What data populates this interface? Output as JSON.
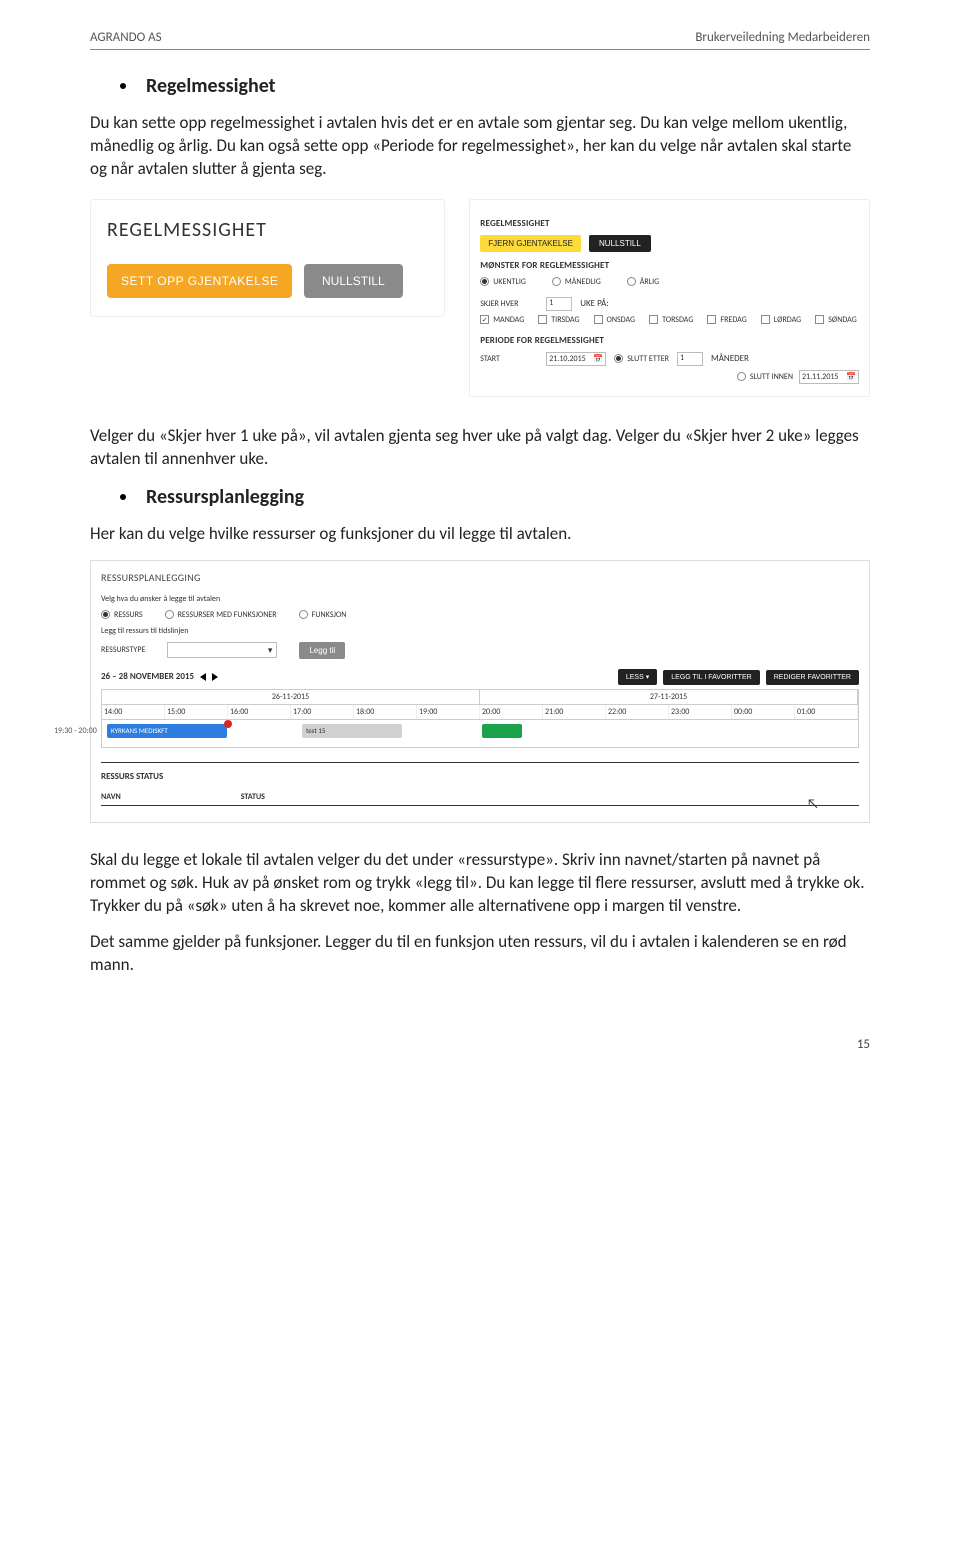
{
  "header": {
    "left": "AGRANDO AS",
    "right": "Brukerveiledning Medarbeideren"
  },
  "s1": {
    "title": "Regelmessighet",
    "p1": "Du kan sette opp regelmessighet i avtalen hvis det er en avtale som gjentar seg. Du kan velge mellom ukentlig, månedlig og årlig. Du kan også sette opp «Periode for regelmessighet», her kan du velge når avtalen skal starte og når avtalen slutter å gjenta seg.",
    "card1": {
      "title": "REGELMESSIGHET",
      "btn_set": "SETT OPP GJENTAKELSE",
      "btn_null": "NULLSTILL"
    },
    "card2": {
      "sect_top": "REGELMESSIGHET",
      "btn_fjern": "FJERN GJENTAKELSE",
      "btn_null": "NULLSTILL",
      "sect_pattern": "MØNSTER FOR REGLEMESSIGHET",
      "radios": [
        "UKENTLIG",
        "MÅNEDLIG",
        "ÅRLIG"
      ],
      "skjer_hver": "SKJER HVER",
      "skjer_val": "1",
      "uke_paa": "UKE PÅ:",
      "days": [
        "MANDAG",
        "TIRSDAG",
        "ONSDAG",
        "TORSDAG",
        "FREDAG",
        "LØRDAG",
        "SØNDAG"
      ],
      "sect_period": "PERIODE FOR REGELMESSIGHET",
      "start_lbl": "START",
      "start_date": "21.10.2015",
      "slutt_etter": "SLUTT ETTER",
      "slutt_etter_val": "1",
      "slutt_unit": "MÅNEDER",
      "slutt_innen": "SLUTT INNEN",
      "slutt_innen_date": "21.11.2015"
    },
    "p2": "Velger du «Skjer hver 1 uke på», vil avtalen gjenta seg hver uke på valgt dag. Velger du «Skjer hver 2 uke» legges avtalen til annenhver uke."
  },
  "s2": {
    "title": "Ressursplanlegging",
    "p1": "Her kan du velge hvilke ressurser og funksjoner du vil legge til avtalen.",
    "card3": {
      "title": "RESSURSPLANLEGGING",
      "sub1": "Velg hva du ønsker å legge til avtalen",
      "radios": [
        "RESSURS",
        "RESSURSER MED FUNKSJONER",
        "FUNKSJON"
      ],
      "sub2": "Legg til ressurs til tidslinjen",
      "type_lbl": "RESSURSTYPE",
      "btn_add": "Legg til",
      "btn_less": "LESS ▾",
      "btn_fav": "LEGG TIL I FAVORITTER",
      "btn_redfav": "REDIGER FAVORITTER",
      "range": "26 – 28 NOVEMBER 2015",
      "days": [
        "26-11-2015",
        "27-11-2015"
      ],
      "hours": [
        "14:00",
        "15:00",
        "16:00",
        "17:00",
        "18:00",
        "19:00",
        "20:00",
        "21:00",
        "22:00",
        "23:00",
        "00:00",
        "01:00"
      ],
      "row_time": "19:30 - 20:00",
      "bar_blue": "KYRKANS MEDISKFT",
      "bar_gray": "test 15",
      "status_lbl": "RESSURS STATUS",
      "col_navn": "NAVN",
      "col_status": "STATUS"
    },
    "p2": "Skal du legge et lokale til avtalen velger du det under «ressurstype». Skriv inn navnet/starten på navnet på rommet og søk. Huk av på ønsket rom og trykk «legg til». Du kan legge til flere ressurser, avslutt med å trykke ok.  Trykker du på «søk» uten å ha skrevet noe, kommer alle alternativene opp i margen til venstre.",
    "p3": "Det samme gjelder på funksjoner. Legger du til en funksjon uten ressurs, vil du i avtalen i kalenderen se en rød mann."
  },
  "page_num": "15"
}
